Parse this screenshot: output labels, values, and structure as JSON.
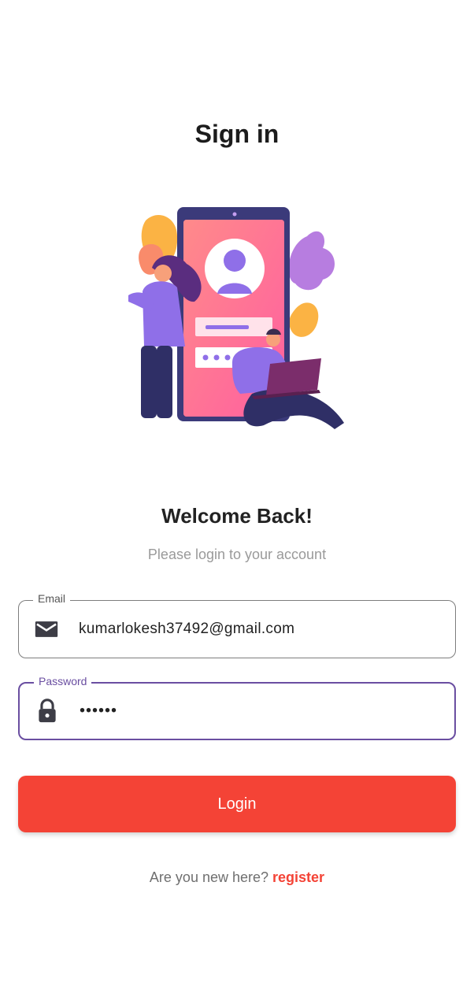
{
  "header": {
    "title": "Sign in"
  },
  "welcome": {
    "heading": "Welcome Back!",
    "subtitle": "Please login to your account"
  },
  "form": {
    "email": {
      "label": "Email",
      "value": "kumarlokesh37492@gmail.com",
      "icon": "mail-icon"
    },
    "password": {
      "label": "Password",
      "value": "••••••",
      "icon": "lock-icon"
    },
    "login_label": "Login"
  },
  "footer": {
    "prompt": "Are you new here?",
    "register_label": "register"
  },
  "colors": {
    "accent": "#f44336",
    "focus": "#6a4ea1"
  }
}
